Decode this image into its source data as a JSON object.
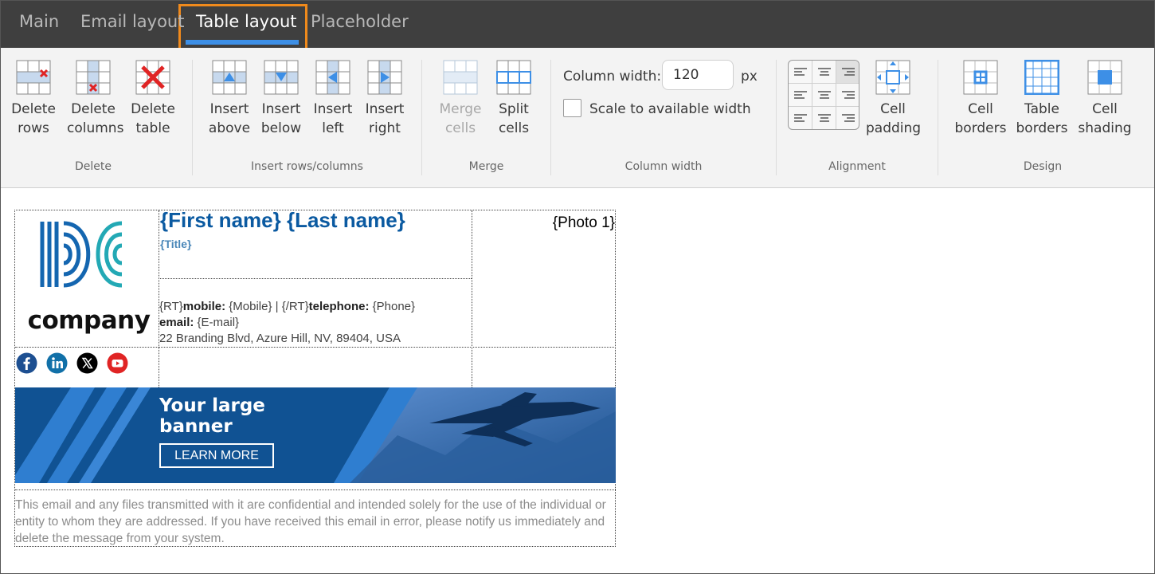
{
  "tabs": [
    {
      "label": "Main",
      "active": false
    },
    {
      "label": "Email layout",
      "active": false
    },
    {
      "label": "Table layout",
      "active": true
    },
    {
      "label": "Placeholder",
      "active": false
    }
  ],
  "ribbon": {
    "delete": {
      "group_label": "Delete",
      "rows": "Delete\nrows",
      "columns": "Delete\ncolumns",
      "table": "Delete\ntable"
    },
    "insert": {
      "group_label": "Insert rows/columns",
      "above": "Insert\nabove",
      "below": "Insert\nbelow",
      "left": "Insert\nleft",
      "right": "Insert\nright"
    },
    "merge": {
      "group_label": "Merge",
      "merge_cells": "Merge\ncells",
      "split_cells": "Split\ncells"
    },
    "column_width": {
      "group_label": "Column width",
      "label": "Column width:",
      "value": "120",
      "unit": "px",
      "scale_label": "Scale to available width",
      "scale_checked": false
    },
    "alignment": {
      "group_label": "Alignment",
      "cell_padding": "Cell\npadding"
    },
    "design": {
      "group_label": "Design",
      "cell_borders": "Cell\nborders",
      "table_borders": "Table\nborders",
      "cell_shading": "Cell\nshading"
    }
  },
  "signature": {
    "logo_text": "company",
    "full_name": "{First name} {Last name}",
    "title": "{Title}",
    "photo": "{Photo 1}",
    "contact": {
      "rt_open": "{RT}",
      "mobile_label": "mobile:",
      "mobile_value": " {Mobile}  |  {/RT}",
      "telephone_label": "telephone:",
      "telephone_value": " {Phone}",
      "email_label": "email:",
      "email_value": " {E-mail}",
      "address": "22 Branding Blvd, Azure Hill, NV, 89404, USA"
    },
    "social_icons": [
      "facebook-icon",
      "linkedin-icon",
      "x-icon",
      "youtube-icon"
    ],
    "banner": {
      "text": "Your large\nbanner",
      "cta": "LEARN MORE"
    },
    "disclaimer": "This email and any files transmitted with it are confidential and intended solely for the use of the individual or entity to whom they are addressed. If you have received this email in error, please notify us immediately and delete the message from your system."
  },
  "colors": {
    "tab_bar": "#3f3f3f",
    "active_tab_outline": "#f08a1c",
    "active_tab_underline": "#3d8fe6",
    "name_blue": "#0b5aa1",
    "icon_red": "#e02424",
    "icon_blue": "#3d8fe6"
  }
}
